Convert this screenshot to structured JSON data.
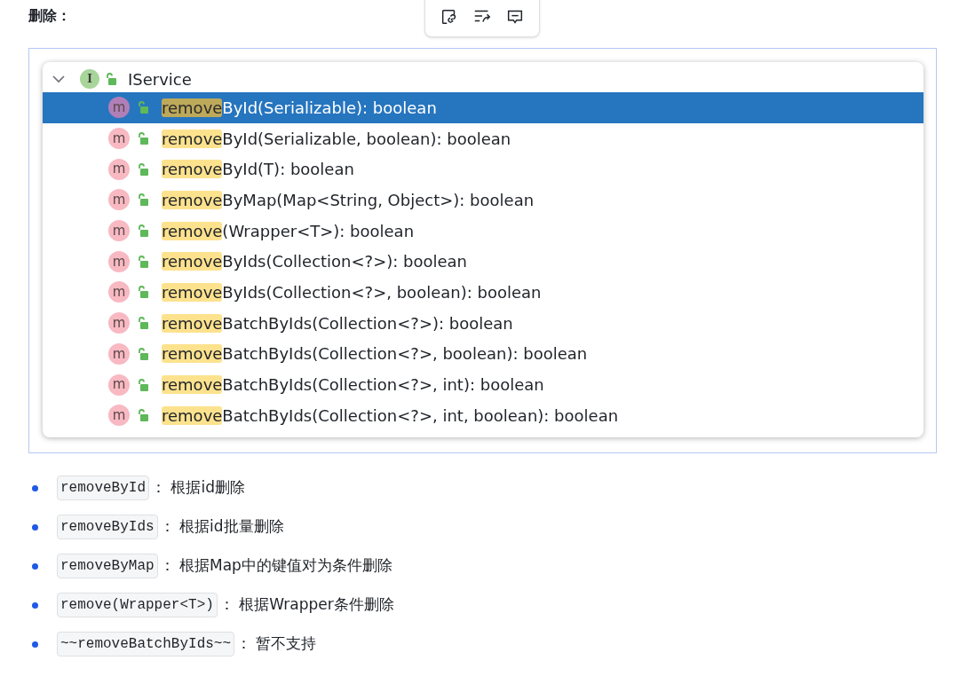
{
  "heading": "删除：",
  "toolbar": [
    {
      "kind": "link"
    },
    {
      "kind": "wrap"
    },
    {
      "kind": "comment"
    }
  ],
  "tree": {
    "expanded": true,
    "label": "IService",
    "badge": "I",
    "items": [
      {
        "badge": "m",
        "match": "remove",
        "rest": "ById(Serializable): boolean",
        "selected": true
      },
      {
        "badge": "m",
        "match": "remove",
        "rest": "ById(Serializable, boolean): boolean",
        "selected": false
      },
      {
        "badge": "m",
        "match": "remove",
        "rest": "ById(T): boolean",
        "selected": false
      },
      {
        "badge": "m",
        "match": "remove",
        "rest": "ByMap(Map<String, Object>): boolean",
        "selected": false
      },
      {
        "badge": "m",
        "match": "remove",
        "rest": "(Wrapper<T>): boolean",
        "selected": false
      },
      {
        "badge": "m",
        "match": "remove",
        "rest": "ByIds(Collection<?>): boolean",
        "selected": false
      },
      {
        "badge": "m",
        "match": "remove",
        "rest": "ByIds(Collection<?>, boolean): boolean",
        "selected": false
      },
      {
        "badge": "m",
        "match": "remove",
        "rest": "BatchByIds(Collection<?>): boolean",
        "selected": false
      },
      {
        "badge": "m",
        "match": "remove",
        "rest": "BatchByIds(Collection<?>, boolean): boolean",
        "selected": false
      },
      {
        "badge": "m",
        "match": "remove",
        "rest": "BatchByIds(Collection<?>, int): boolean",
        "selected": false
      },
      {
        "badge": "m",
        "match": "remove",
        "rest": "BatchByIds(Collection<?>, int, boolean): boolean",
        "selected": false
      }
    ]
  },
  "list": [
    {
      "code": "removeById",
      "desc": "： 根据id删除"
    },
    {
      "code": "removeByIds",
      "desc": "： 根据id批量删除"
    },
    {
      "code": "removeByMap",
      "desc": "： 根据Map中的键值对为条件删除"
    },
    {
      "code": "remove(Wrapper<T>)",
      "desc": "： 根据Wrapper条件删除"
    },
    {
      "code": "~~removeBatchByIds~~",
      "desc": "： 暂不支持"
    }
  ]
}
